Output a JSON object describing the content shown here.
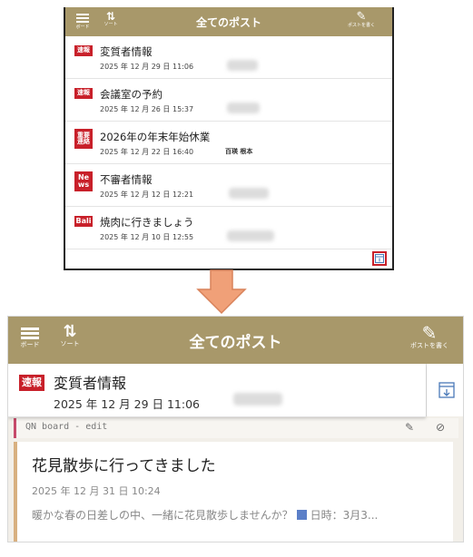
{
  "header": {
    "title": "全てのポスト",
    "menu_caption": "ボード",
    "sort_caption": "ソート",
    "write_caption": "ポストを書く",
    "color": "#a8986a"
  },
  "top_list": [
    {
      "badge": "速報",
      "subject": "変質者情報",
      "date": "2025 年 12 月 29 日 11:06",
      "name": ""
    },
    {
      "badge": "速報",
      "subject": "会議室の予約",
      "date": "2025 年 12 月 26 日 15:37",
      "name": ""
    },
    {
      "badge": "重要連絡",
      "subject": "2026年の年末年始休業",
      "date": "2025 年 12 月 22 日 16:40",
      "name": "百瑛 根本"
    },
    {
      "badge": "News",
      "subject": "不審者情報",
      "date": "2025 年 12 月 12 日 12:21",
      "name": ""
    },
    {
      "badge": "Bali",
      "subject": "焼肉に行きましょう",
      "date": "2025 年 12 月 10 日 12:55",
      "name": ""
    }
  ],
  "pinned": {
    "badge": "速報",
    "subject": "変質者情報",
    "date": "2025 年 12 月 29 日 11:06"
  },
  "board_bar": {
    "label": "QN board - edit"
  },
  "card": {
    "subject": "花見散歩に行ってきました",
    "date": "2025 年 12 月 31 日 10:24",
    "body_before": "暖かな春の日差しの中、一緒に花見散歩しませんか？",
    "body_after": "日時：3月3..."
  },
  "colors": {
    "badge_red": "#c8202a",
    "arrow": "#f0a078",
    "accent": "#c64a6a"
  }
}
